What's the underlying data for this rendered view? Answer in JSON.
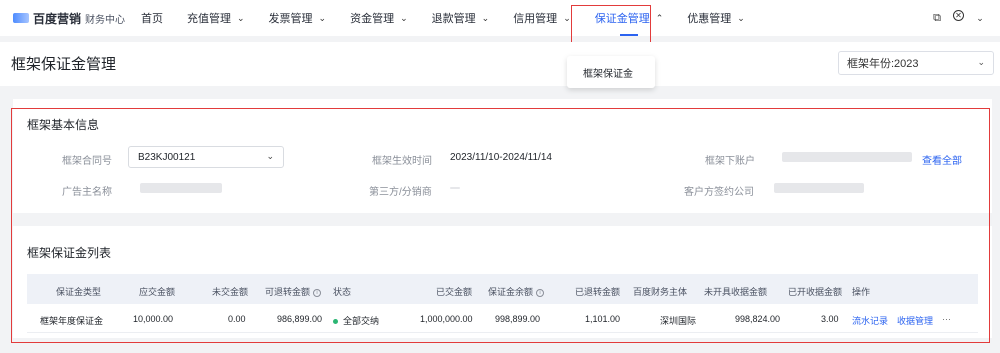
{
  "nav": {
    "logo_text": "百度营销",
    "logo_sub": "财务中心",
    "items": [
      {
        "label": "首页",
        "chevron": false
      },
      {
        "label": "充值管理",
        "chevron": true
      },
      {
        "label": "发票管理",
        "chevron": true
      },
      {
        "label": "资金管理",
        "chevron": true
      },
      {
        "label": "退款管理",
        "chevron": true
      },
      {
        "label": "信用管理",
        "chevron": true
      },
      {
        "label": "保证金管理",
        "chevron": true,
        "active": true
      },
      {
        "label": "优惠管理",
        "chevron": true
      }
    ],
    "dropdown_item": "框架保证金",
    "right_icons": [
      "copy-icon",
      "close-circle-icon",
      "chevron-down-icon"
    ]
  },
  "page": {
    "title": "框架保证金管理",
    "frame_select_value": "框架年份:2023"
  },
  "basic_info": {
    "title": "框架基本信息",
    "contract_no_label": "框架合同号",
    "contract_no_value": "B23KJ00121",
    "effective_time_label": "框架生效时间",
    "effective_time_value": "2023/11/10-2024/11/14",
    "sub_accounts_label": "框架下账户",
    "view_all": "查看全部",
    "advertiser_label": "广告主名称",
    "third_party_label": "第三方/分销商",
    "service_company_label": "客户方签约公司"
  },
  "deposit_list": {
    "title": "框架保证金列表",
    "columns": [
      "保证金类型",
      "应交金额",
      "未交金额",
      "可退转金额",
      "状态",
      "已交金额",
      "保证金余额",
      "已退转金额",
      "百度财务主体",
      "未开具收据金额",
      "已开收据金额",
      "操作"
    ],
    "rows": [
      {
        "type": "框架年度保证金",
        "payable": "10,000.00",
        "unpaid": "0.00",
        "refundable": "986,899.00",
        "status": "全部交纳",
        "paid": "1,000,000.00",
        "balance": "998,899.00",
        "refunded": "1,101.00",
        "entity": "深圳国际",
        "unreceipted": "998,824.00",
        "receipted": "3.00",
        "action_flow": "流水记录",
        "action_receipt": "收据管理",
        "action_more": "···"
      }
    ]
  },
  "colors": {
    "accent": "#2b63f0",
    "highlight": "#e23b3b",
    "status_green": "#2bb673"
  }
}
